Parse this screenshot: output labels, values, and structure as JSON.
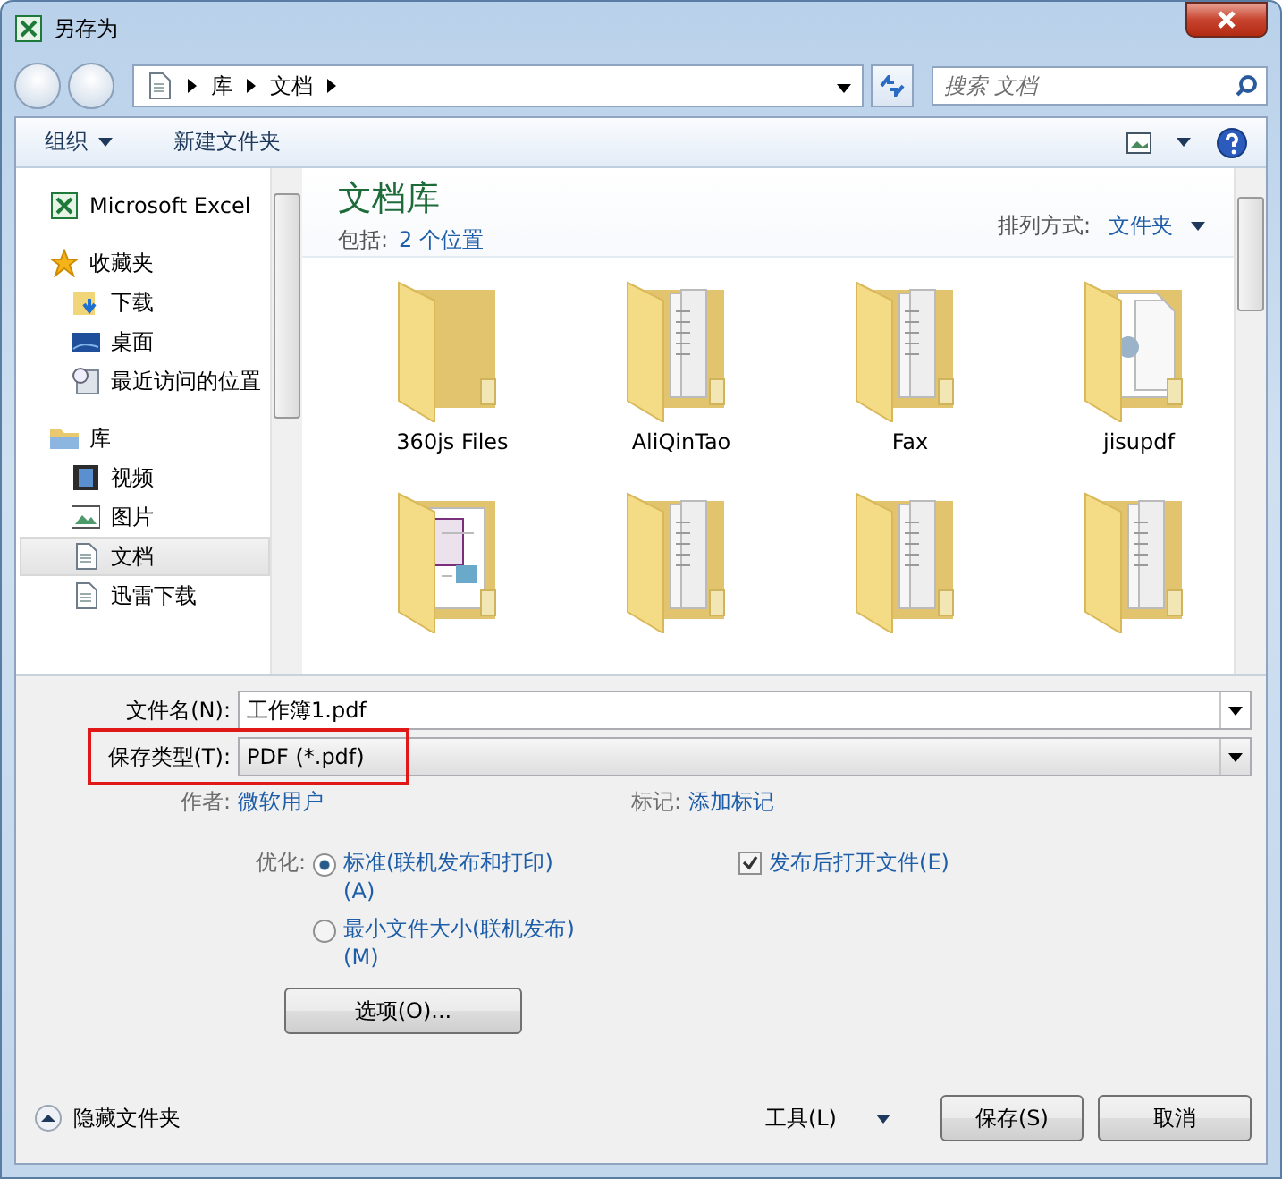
{
  "window": {
    "title": "另存为"
  },
  "nav": {
    "breadcrumb": [
      "库",
      "文档"
    ],
    "search_placeholder": "搜索 文档"
  },
  "toolbar": {
    "buttons": [
      {
        "label": "组织",
        "dropdown": true
      },
      {
        "label": "新建文件夹",
        "dropdown": false
      }
    ]
  },
  "sidebar": {
    "sections": [
      {
        "label": "Microsoft Excel",
        "kind": "excel",
        "selected": false
      },
      {
        "label": "收藏夹",
        "kind": "star",
        "selected": false,
        "children": [
          {
            "label": "下载",
            "kind": "download",
            "selected": false
          },
          {
            "label": "桌面",
            "kind": "desktop",
            "selected": false
          },
          {
            "label": "最近访问的位置",
            "kind": "recent",
            "selected": false
          }
        ]
      },
      {
        "label": "库",
        "kind": "library",
        "selected": false,
        "children": [
          {
            "label": "视频",
            "kind": "video",
            "selected": false
          },
          {
            "label": "图片",
            "kind": "image",
            "selected": false
          },
          {
            "label": "文档",
            "kind": "document",
            "selected": true
          },
          {
            "label": "迅雷下载",
            "kind": "document",
            "selected": false
          }
        ]
      }
    ]
  },
  "content": {
    "title": "文档库",
    "includes_label": "包括:",
    "includes_link": "2 个位置",
    "sort_label": "排列方式:",
    "sort_value": "文件夹",
    "folders": [
      {
        "name": "360js Files",
        "kind": "plain"
      },
      {
        "name": "AliQinTao",
        "kind": "docs"
      },
      {
        "name": "Fax",
        "kind": "docs"
      },
      {
        "name": "jisupdf",
        "kind": "pages"
      },
      {
        "kind": "picture"
      },
      {
        "kind": "docs"
      },
      {
        "kind": "docs"
      },
      {
        "kind": "docs"
      }
    ]
  },
  "form": {
    "file_name_label": "文件名(N):",
    "file_name": "工作簿1.pdf",
    "save_type_label": "保存类型(T):",
    "save_type": "PDF (*.pdf)",
    "save_type_highlighted": true,
    "author_label": "作者:",
    "author": "微软用户",
    "tags_label": "标记:",
    "tags": "添加标记",
    "optimize_label": "优化:",
    "optimize_options": [
      {
        "label": "标准(联机发布和打印)(A)",
        "selected": true
      },
      {
        "label": "最小文件大小(联机发布)(M)",
        "selected": false
      }
    ],
    "open_after": {
      "label": "发布后打开文件(E)",
      "checked": true
    },
    "options_button": "选项(O)..."
  },
  "footer": {
    "hide_folders": "隐藏文件夹",
    "tools": "工具(L)",
    "save": "保存(S)",
    "cancel": "取消"
  }
}
